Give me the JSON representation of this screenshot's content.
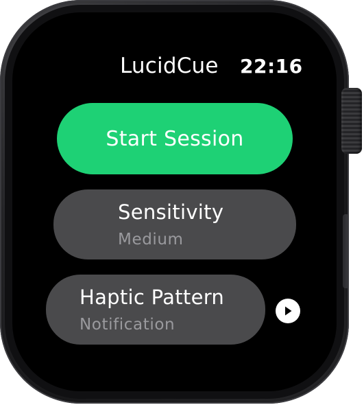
{
  "header": {
    "app_title": "LucidCue",
    "time": "22:16"
  },
  "actions": {
    "start_label": "Start Session"
  },
  "settings": {
    "sensitivity": {
      "title": "Sensitivity",
      "value": "Medium"
    },
    "haptic": {
      "title": "Haptic Pattern",
      "value": "Notification"
    }
  },
  "icons": {
    "preview": "play-icon",
    "crown": "digital-crown"
  },
  "colors": {
    "start_button": "#1ed175",
    "setting_button": "#4a4a4c",
    "screen_background": "#000000",
    "secondary_text": "#9a9a9e"
  }
}
